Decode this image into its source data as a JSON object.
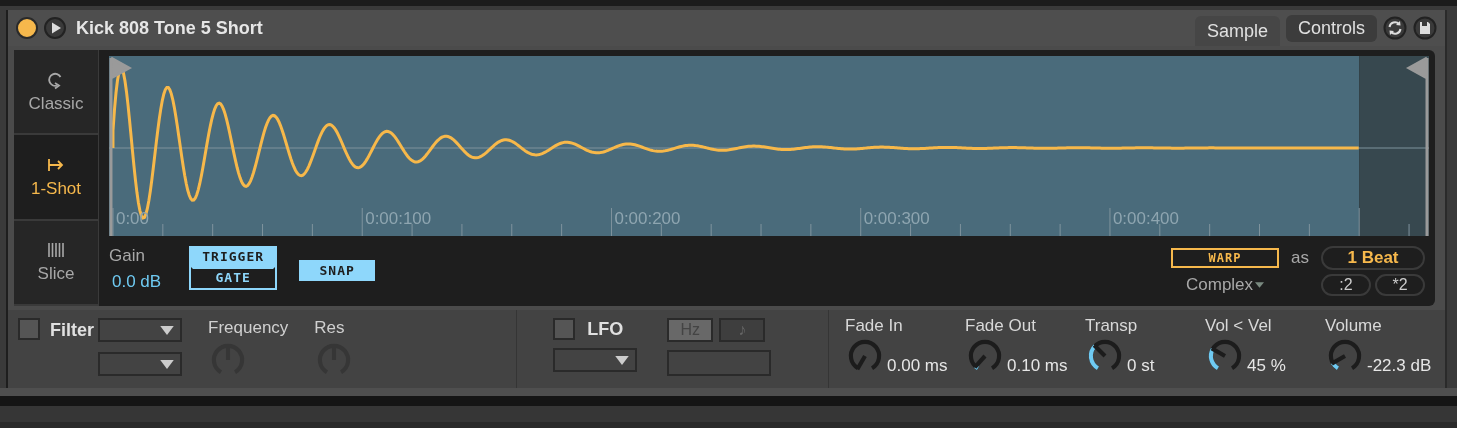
{
  "device": {
    "title": "Kick 808 Tone 5 Short",
    "active": true,
    "views": [
      {
        "label": "Sample",
        "selected": true
      },
      {
        "label": "Controls",
        "selected": false
      }
    ]
  },
  "modes": [
    {
      "kind": "classic",
      "label": "Classic",
      "selected": false
    },
    {
      "kind": "oneshot",
      "label": "1-Shot",
      "selected": true
    },
    {
      "kind": "slice",
      "label": "Slice",
      "selected": false
    }
  ],
  "waveform": {
    "time_labels": [
      "0:00",
      "0:00:100",
      "0:00:200",
      "0:00:300",
      "0:00:400"
    ]
  },
  "sample": {
    "gain_label": "Gain",
    "gain_value": "0.0 dB",
    "trigger_modes": [
      {
        "label": "TRIGGER",
        "selected": true
      },
      {
        "label": "GATE",
        "selected": false
      }
    ],
    "snap": {
      "label": "SNAP",
      "on": true
    },
    "warp": {
      "label": "WARP",
      "on": false
    },
    "as_label": "as",
    "beats": "1 Beat",
    "warp_mode": "Complex",
    "halve": ":2",
    "double": "*2"
  },
  "filter": {
    "label": "Filter",
    "on": false,
    "knobs": [
      {
        "label": "Frequency",
        "disabled": true
      },
      {
        "label": "Res",
        "disabled": true
      }
    ]
  },
  "lfo": {
    "label": "LFO",
    "on": false,
    "units": [
      {
        "label": "Hz",
        "selected": true
      },
      {
        "label": "♪",
        "selected": false
      }
    ]
  },
  "knobs": [
    {
      "label": "Fade In",
      "reading": "0.00 ms"
    },
    {
      "label": "Fade Out",
      "reading": "0.10 ms"
    },
    {
      "label": "Transp",
      "reading": "0 st"
    },
    {
      "label": "Vol < Vel",
      "reading": "45 %"
    },
    {
      "label": "Volume",
      "reading": "-22.3 dB"
    }
  ]
}
